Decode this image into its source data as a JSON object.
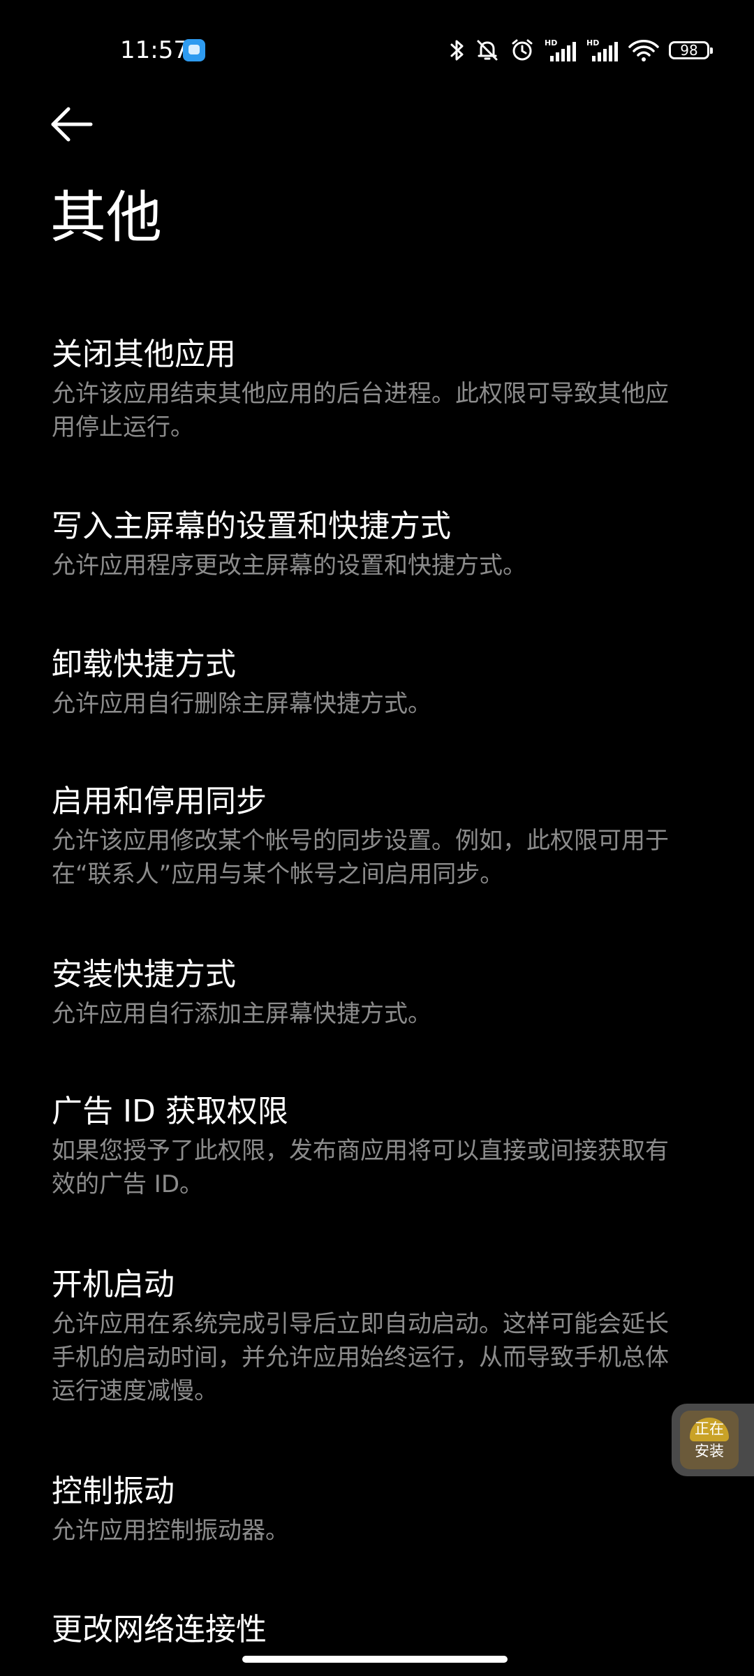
{
  "status_bar": {
    "time": "11:57",
    "battery": "98",
    "icons": [
      "bluetooth-icon",
      "mute-icon",
      "alarm-icon",
      "hd-signal-icon",
      "hd-signal-icon",
      "wifi-icon",
      "battery-icon"
    ]
  },
  "header": {
    "back_icon": "back-arrow-icon",
    "title": "其他"
  },
  "permissions": [
    {
      "title": "关闭其他应用",
      "desc": "允许该应用结束其他应用的后台进程。此权限可导致其他应用停止运行。"
    },
    {
      "title": "写入主屏幕的设置和快捷方式",
      "desc": "允许应用程序更改主屏幕的设置和快捷方式。"
    },
    {
      "title": "卸载快捷方式",
      "desc": "允许应用自行删除主屏幕快捷方式。"
    },
    {
      "title": "启用和停用同步",
      "desc": "允许该应用修改某个帐号的同步设置。例如，此权限可用于在“联系人”应用与某个帐号之间启用同步。"
    },
    {
      "title": "安装快捷方式",
      "desc": "允许应用自行添加主屏幕快捷方式。"
    },
    {
      "title": "广告 ID 获取权限",
      "desc": "如果您授予了此权限，发布商应用将可以直接或间接获取有效的广告 ID。"
    },
    {
      "title": "开机启动",
      "desc": "允许应用在系统完成引导后立即自动启动。这样可能会延长手机的启动时间，并允许应用始终运行，从而导致手机总体运行速度减慢。"
    },
    {
      "title": "控制振动",
      "desc": "允许应用控制振动器。"
    },
    {
      "title": "更改网络连接性",
      "desc": ""
    }
  ],
  "install_widget": {
    "label": "正在\n安装"
  },
  "colors": {
    "background": "#000000",
    "title_text": "#ffffff",
    "desc_text": "#8c8c8c",
    "widget_bg": "#4a4a4a"
  }
}
